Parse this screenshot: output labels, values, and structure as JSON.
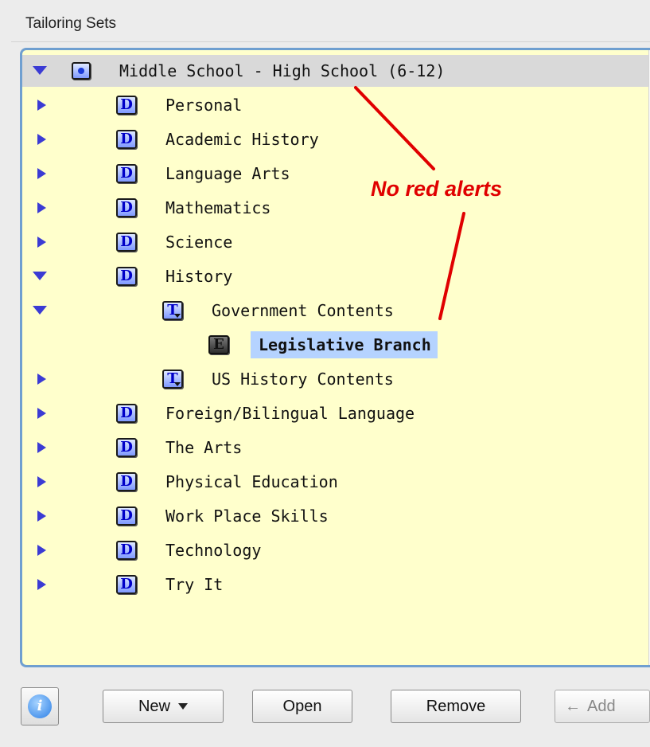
{
  "panel": {
    "title": "Tailoring Sets"
  },
  "tree": {
    "rows": [
      {
        "id": "root",
        "label": "Middle School - High School (6-12)",
        "expanded": true,
        "icon": "root-set-icon"
      },
      {
        "id": "personal",
        "label": "Personal",
        "expanded": false,
        "icon": "D"
      },
      {
        "id": "academic-history",
        "label": "Academic History",
        "expanded": false,
        "icon": "D"
      },
      {
        "id": "language-arts",
        "label": "Language Arts",
        "expanded": false,
        "icon": "D"
      },
      {
        "id": "mathematics",
        "label": "Mathematics",
        "expanded": false,
        "icon": "D"
      },
      {
        "id": "science",
        "label": "Science",
        "expanded": false,
        "icon": "D"
      },
      {
        "id": "history",
        "label": "History",
        "expanded": true,
        "icon": "D"
      },
      {
        "id": "government-contents",
        "label": "Government Contents",
        "expanded": true,
        "icon": "T"
      },
      {
        "id": "legislative-branch",
        "label": "Legislative Branch",
        "icon": "E",
        "highlighted": true
      },
      {
        "id": "us-history-contents",
        "label": "US History Contents",
        "expanded": false,
        "icon": "T"
      },
      {
        "id": "foreign-bilingual",
        "label": "Foreign/Bilingual Language",
        "expanded": false,
        "icon": "D"
      },
      {
        "id": "the-arts",
        "label": "The Arts",
        "expanded": false,
        "icon": "D"
      },
      {
        "id": "physical-education",
        "label": "Physical Education",
        "expanded": false,
        "icon": "D"
      },
      {
        "id": "work-place-skills",
        "label": "Work Place Skills",
        "expanded": false,
        "icon": "D"
      },
      {
        "id": "technology",
        "label": "Technology",
        "expanded": false,
        "icon": "D"
      },
      {
        "id": "try-it",
        "label": "Try It",
        "expanded": false,
        "icon": "D"
      }
    ]
  },
  "icons": {
    "domain": "D",
    "template": "T",
    "element": "E"
  },
  "annotation": {
    "text": "No red alerts",
    "color": "#e00000"
  },
  "toolbar": {
    "info": "i",
    "new": "New",
    "open": "Open",
    "remove": "Remove",
    "add": "Add",
    "add_arrow": "←"
  },
  "colors": {
    "tree_background": "#ffffcc",
    "tree_border": "#6f9fd0",
    "expand_arrow": "#3b3bd4",
    "highlight": "#b5d3ff"
  }
}
